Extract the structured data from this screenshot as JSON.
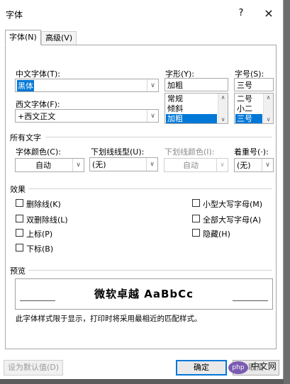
{
  "dialog": {
    "title": "字体",
    "help": "?",
    "close": "×"
  },
  "tabs": [
    {
      "label": "字体(N)"
    },
    {
      "label": "高级(V)"
    }
  ],
  "chinese_font": {
    "label": "中文字体(T):",
    "value": "黑体"
  },
  "western_font": {
    "label": "西文字体(F):",
    "value": "+西文正文"
  },
  "font_style": {
    "label": "字形(Y):",
    "value": "加粗",
    "options": [
      "常规",
      "倾斜",
      "加粗"
    ],
    "selected": "加粗"
  },
  "font_size": {
    "label": "字号(S):",
    "value": "三号",
    "options": [
      "二号",
      "小二",
      "三号"
    ],
    "selected": "三号"
  },
  "all_text": {
    "section_title": "所有文字",
    "font_color": {
      "label": "字体颜色(C):",
      "value": "自动"
    },
    "underline_style": {
      "label": "下划线线型(U):",
      "value": "(无)"
    },
    "underline_color": {
      "label": "下划线颜色(I):",
      "value": "自动"
    },
    "emphasis_mark": {
      "label": "着重号(·):",
      "value": "(无)"
    }
  },
  "effects": {
    "section_title": "效果",
    "strikethrough": "删除线(K)",
    "double_strikethrough": "双删除线(L)",
    "superscript": "上标(P)",
    "subscript": "下标(B)",
    "small_caps": "小型大写字母(M)",
    "all_caps": "全部大写字母(A)",
    "hidden": "隐藏(H)"
  },
  "preview": {
    "section_title": "预览",
    "sample": "微软卓越  AaBbCc",
    "note": "此字体样式限于显示，打印时将采用最相近的匹配样式。"
  },
  "buttons": {
    "set_default": "设为默认值(D)",
    "ok": "确定",
    "cancel_partial": "取消"
  },
  "watermark": {
    "badge": "php",
    "text": "中文网"
  },
  "colors": {
    "accent": "#0078d7",
    "selection": "#0078d7"
  }
}
